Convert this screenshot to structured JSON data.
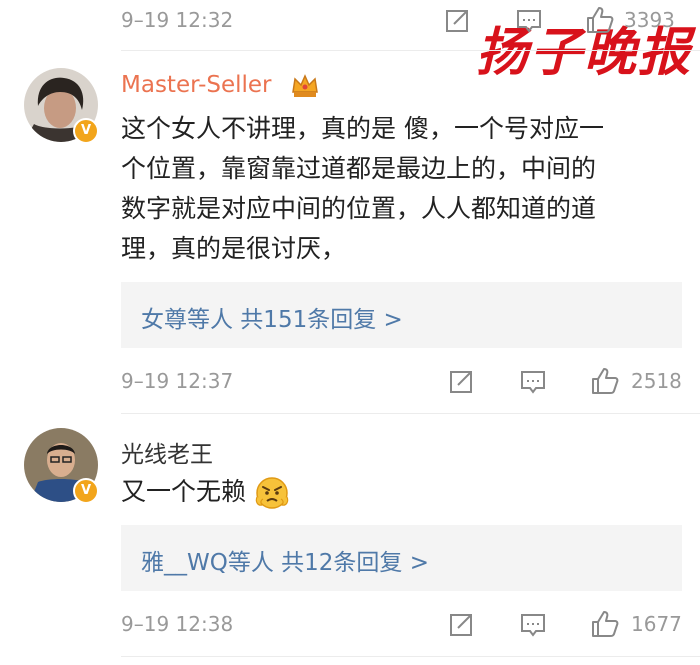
{
  "watermark": {
    "text": "扬子晚报",
    "color": "#d8121b"
  },
  "colors": {
    "meta": "#999999",
    "link": "#4f79a8",
    "username_highlight": "#eb7350",
    "badge": "#f2a51b"
  },
  "top_row": {
    "time": "9–19 12:32",
    "likes": "3393"
  },
  "comments": [
    {
      "username": "Master-Seller",
      "crown_icon": "crown-icon",
      "text_lines": [
        "这个女人不讲理，真的是 傻，一个号对应一",
        "个位置，靠窗靠过道都是最边上的，中间的",
        "数字就是对应中间的位置，人人都知道的道",
        "理，真的是很讨厌，"
      ],
      "replies": "女尊等人  共151条回复 >",
      "time": "9–19 12:37",
      "likes": "2518",
      "verified_badge": "V"
    },
    {
      "username": "光线老王",
      "text": "又一个无赖",
      "emoji": "angry-face-emoji",
      "replies": "雅__WQ等人  共12条回复 >",
      "time": "9–19 12:38",
      "likes": "1677",
      "verified_badge": "V"
    }
  ]
}
